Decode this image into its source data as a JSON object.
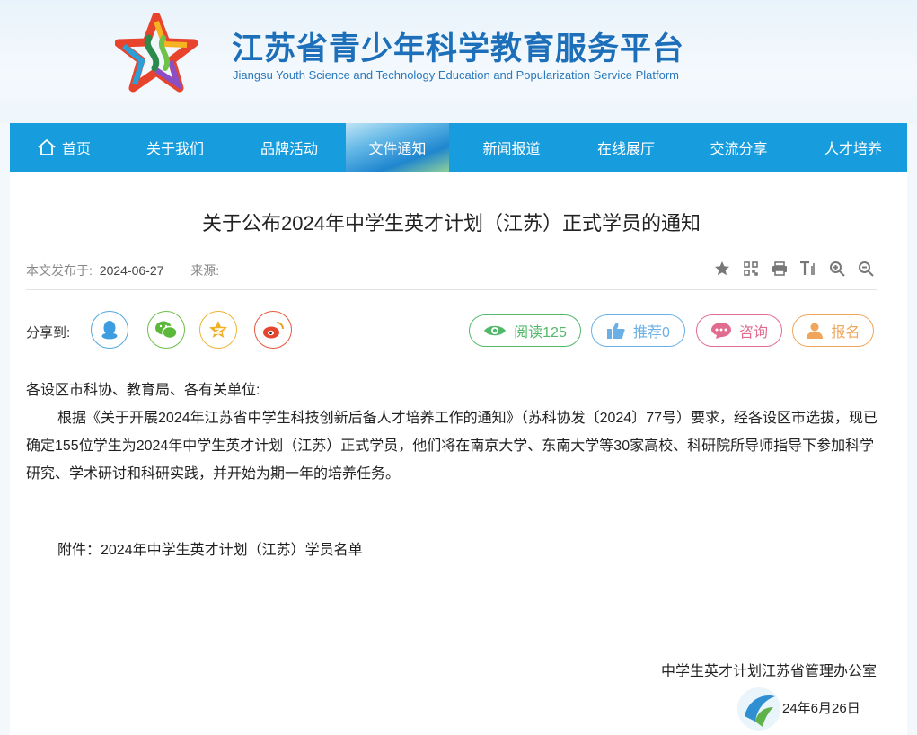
{
  "header": {
    "title": "江苏省青少年科学教育服务平台",
    "subtitle": "Jiangsu Youth Science and Technology Education and Popularization Service Platform"
  },
  "nav": {
    "items": [
      {
        "label": "首页"
      },
      {
        "label": "关于我们"
      },
      {
        "label": "品牌活动"
      },
      {
        "label": "文件通知"
      },
      {
        "label": "新闻报道"
      },
      {
        "label": "在线展厅"
      },
      {
        "label": "交流分享"
      },
      {
        "label": "人才培养"
      }
    ],
    "active": "文件通知"
  },
  "article": {
    "title": "关于公布2024年中学生英才计划（江苏）正式学员的通知",
    "publish_label": "本文发布于:",
    "publish_date": "2024-06-27",
    "source_label": "来源:",
    "share_label": "分享到:",
    "stats": {
      "read": "阅读125",
      "recommend": "推荐0",
      "consult": "咨询",
      "signup": "报名"
    },
    "greeting": "各设区市科协、教育局、各有关单位:",
    "paragraph": "根据《关于开展2024年江苏省中学生科技创新后备人才培养工作的通知》（苏科协发〔2024〕77号）要求，经各设区市选拔，现已确定155位学生为2024年中学生英才计划（江苏）正式学员，他们将在南京大学、东南大学等30家高校、科研院所导师指导下参加科学研究、学术研讨和科研实践，并开始为期一年的培养任务。",
    "attachment": "附件：2024年中学生英才计划（江苏）学员名单",
    "signature": "中学生英才计划江苏省管理办公室",
    "signature_date": "24年6月26日"
  },
  "icons": {
    "tools": [
      "star-icon",
      "qrcode-icon",
      "print-icon",
      "text-size-icon",
      "zoom-in-icon",
      "zoom-out-icon"
    ],
    "share": [
      "qq-icon",
      "wechat-icon",
      "qzone-icon",
      "weibo-icon"
    ]
  },
  "colors": {
    "nav_bg": "#179ddd",
    "title_blue": "#1c6fb8",
    "read_green": "#52b96b",
    "recommend_blue": "#6ab0e6",
    "consult_pink": "#e26b90",
    "signup_orange": "#f0a55a"
  }
}
